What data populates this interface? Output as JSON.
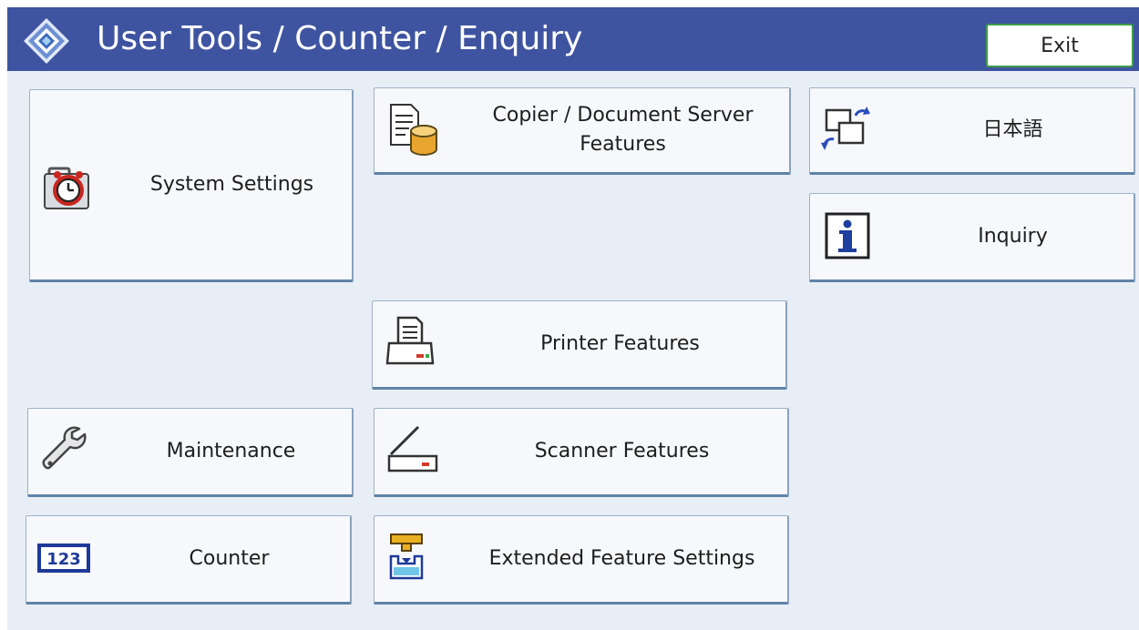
{
  "header": {
    "title": "User Tools / Counter / Enquiry",
    "exit_label": "Exit"
  },
  "buttons": {
    "system_settings": "System Settings",
    "copier_document_server": "Copier / Document Server Features",
    "japanese": "日本語",
    "inquiry": "Inquiry",
    "printer_features": "Printer Features",
    "maintenance": "Maintenance",
    "scanner_features": "Scanner Features",
    "counter": "Counter",
    "extended_feature_settings": "Extended Feature Settings"
  },
  "icons": {
    "logo": "diamond-logo-icon",
    "system_settings": "toolbox-clock-icon",
    "copier": "document-server-icon",
    "language": "language-switch-icon",
    "inquiry": "info-icon",
    "printer": "printer-icon",
    "maintenance": "wrench-icon",
    "scanner": "scanner-icon",
    "counter": "counter-123-icon",
    "extended": "extended-feature-icon"
  },
  "counter_icon_text": "123",
  "colors": {
    "header_bg": "#3f54a0",
    "body_bg": "#e8eef5",
    "exit_border": "#3c9c48"
  }
}
